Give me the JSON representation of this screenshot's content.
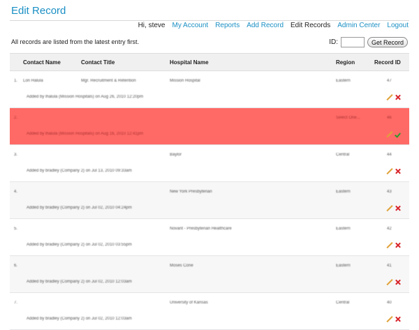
{
  "page": {
    "title": "Edit Record"
  },
  "nav": {
    "greeting": "Hi, steve",
    "links": [
      "My Account",
      "Reports",
      "Add Record"
    ],
    "current": "Edit Records",
    "links2": [
      "Admin Center",
      "Logout"
    ]
  },
  "note": "All records are listed from the latest entry first.",
  "id_search": {
    "label": "ID:",
    "value": "",
    "button": "Get Record"
  },
  "table": {
    "headers": {
      "contact": "Contact Name",
      "title": "Contact Title",
      "hospital": "Hospital Name",
      "region": "Region",
      "record_id": "Record ID"
    },
    "rows": [
      {
        "num": "1.",
        "contact": "Lori Halula",
        "title": "Mgr. Recruitment & Retention",
        "hospital": "Mission Hospital",
        "region": "Eastern",
        "id": "47",
        "added": "Added by lhalula (Mission Hospitals) on Aug 26, 2010 12:20pm",
        "state": "normal"
      },
      {
        "num": "2.",
        "contact": "",
        "title": "",
        "hospital": "",
        "region": "Select One...",
        "id": "46",
        "added": "Added by lhalula (Mission Hospitals) on Aug 16, 2010 12:41pm",
        "state": "selected"
      },
      {
        "num": "3.",
        "contact": "",
        "title": "",
        "hospital": "Baylor",
        "region": "Central",
        "id": "44",
        "added": "Added by bradley (Company 2) on Jul 13, 2010 09:33am",
        "state": "normal"
      },
      {
        "num": "4.",
        "contact": "",
        "title": "",
        "hospital": "New York Presbyterian",
        "region": "Eastern",
        "id": "43",
        "added": "Added by bradley (Company 2) on Jul 02, 2010 04:24pm",
        "state": "alt"
      },
      {
        "num": "5.",
        "contact": "",
        "title": "",
        "hospital": "Novant - Presbyterian Healthcare",
        "region": "Eastern",
        "id": "42",
        "added": "Added by bradley (Company 2) on Jul 02, 2010 03:55pm",
        "state": "normal"
      },
      {
        "num": "6.",
        "contact": "",
        "title": "",
        "hospital": "Moses Cone",
        "region": "Eastern",
        "id": "41",
        "added": "Added by bradley (Company 2) on Jul 02, 2010 12:03am",
        "state": "alt"
      },
      {
        "num": "7.",
        "contact": "",
        "title": "",
        "hospital": "University of Kansas",
        "region": "Central",
        "id": "40",
        "added": "Added by bradley (Company 2) on Jul 02, 2010 12:03am",
        "state": "normal"
      }
    ]
  },
  "icons": {
    "edit": "pencil-icon",
    "delete": "delete-icon",
    "confirm": "check-icon"
  },
  "colors": {
    "accent": "#1a8fc4",
    "selected_row": "#ff6a66"
  }
}
